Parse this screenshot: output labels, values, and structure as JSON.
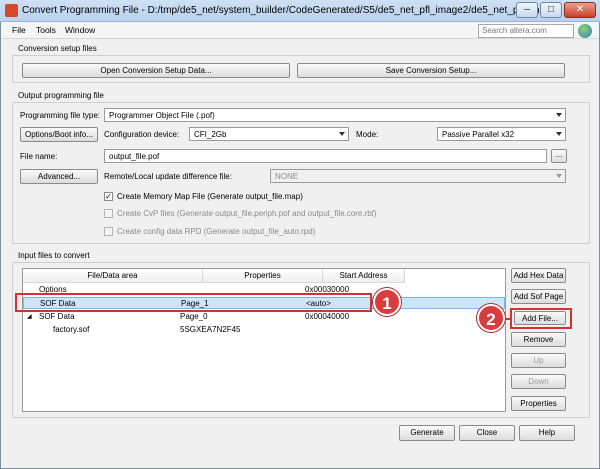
{
  "window": {
    "title": "Convert Programming File - D:/tmp/de5_net/system_builder/CodeGenerated/S5/de5_net_pfl_image2/de5_net_pfl_ima...",
    "min_glyph": "–",
    "max_glyph": "□",
    "close_glyph": "✕"
  },
  "menu": {
    "items": [
      "File",
      "Tools",
      "Window"
    ],
    "search_placeholder": "Search altera.com"
  },
  "conversion_setup": {
    "label": "Conversion setup files",
    "open_label": "Open Conversion Setup Data...",
    "save_label": "Save Conversion Setup..."
  },
  "output": {
    "label": "Output programming file",
    "file_type_label": "Programming file type:",
    "file_type_value": "Programmer Object File (.pof)",
    "options_boot_label": "Options/Boot info...",
    "config_device_label": "Configuration device:",
    "config_device_value": "CFI_2Gb",
    "mode_label": "Mode:",
    "mode_value": "Passive Parallel x32",
    "file_name_label": "File name:",
    "file_name_value": "output_file.pof",
    "browse_label": "...",
    "advanced_label": "Advanced...",
    "remote_label": "Remote/Local update difference file:",
    "remote_value": "NONE",
    "memory_map_label": "Create Memory Map File (Generate output_file.map)",
    "memory_map_checked": true,
    "cvp_label": "Create CvP files (Generate output_file.periph.pof and output_file.core.rbf)",
    "rpd_label": "Create config data RPD (Generate output_file_auto.rpd)"
  },
  "input": {
    "label": "Input files to convert",
    "columns": [
      "File/Data area",
      "Properties",
      "Start Address"
    ],
    "rows": [
      {
        "name": "Options",
        "props": "",
        "addr": "0x00030000",
        "indent": 1,
        "selected": false
      },
      {
        "name": "SOF Data",
        "props": "Page_1",
        "addr": "<auto>",
        "indent": 1,
        "selected": true
      },
      {
        "name": "SOF Data",
        "props": "Page_0",
        "addr": "0x00040000",
        "indent": 1,
        "selected": false,
        "expand": "◢"
      },
      {
        "name": "factory.sof",
        "props": "5SGXEA7N2F45",
        "addr": "",
        "indent": 2,
        "selected": false
      }
    ],
    "buttons": {
      "add_hex": "Add Hex Data",
      "add_sof": "Add Sof Page",
      "add_file": "Add File...",
      "remove": "Remove",
      "up": "Up",
      "down": "Down",
      "properties": "Properties"
    }
  },
  "footer": {
    "generate": "Generate",
    "close": "Close",
    "help": "Help"
  },
  "annotations": {
    "one": "1",
    "two": "2",
    "color": "#d83030"
  }
}
